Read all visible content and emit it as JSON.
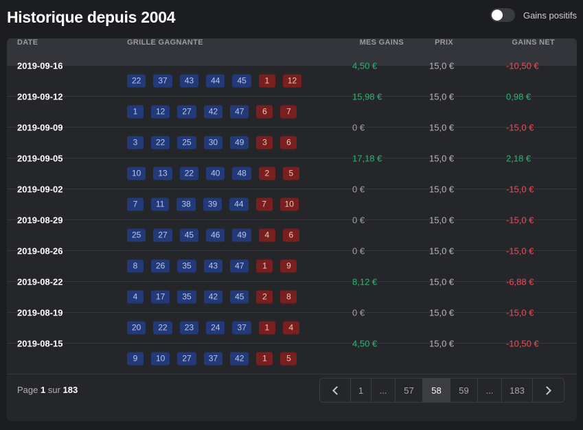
{
  "header": {
    "title": "Historique depuis 2004",
    "toggle_label": "Gains positifs",
    "toggle_on": false
  },
  "table": {
    "columns": {
      "date": "DATE",
      "grille": "GRILLE GAGNANTE",
      "mes_gains": "MES GAINS",
      "prix": "PRIX",
      "gains_net": "GAINS NET"
    },
    "rows": [
      {
        "date": "2019-09-16",
        "balls": [
          "22",
          "37",
          "43",
          "44",
          "45"
        ],
        "stars": [
          "1",
          "12"
        ],
        "gains": "4,50 €",
        "gains_type": "pos",
        "prix": "15,0 €",
        "net": "-10,50 €",
        "net_type": "neg"
      },
      {
        "date": "2019-09-12",
        "balls": [
          "1",
          "12",
          "27",
          "42",
          "47"
        ],
        "stars": [
          "6",
          "7"
        ],
        "gains": "15,98 €",
        "gains_type": "pos",
        "prix": "15,0 €",
        "net": "0,98 €",
        "net_type": "pos"
      },
      {
        "date": "2019-09-09",
        "balls": [
          "3",
          "22",
          "25",
          "30",
          "49"
        ],
        "stars": [
          "3",
          "6"
        ],
        "gains": "0 €",
        "gains_type": "zero",
        "prix": "15,0 €",
        "net": "-15,0 €",
        "net_type": "neg"
      },
      {
        "date": "2019-09-05",
        "balls": [
          "10",
          "13",
          "22",
          "40",
          "48"
        ],
        "stars": [
          "2",
          "5"
        ],
        "gains": "17,18 €",
        "gains_type": "pos",
        "prix": "15,0 €",
        "net": "2,18 €",
        "net_type": "pos"
      },
      {
        "date": "2019-09-02",
        "balls": [
          "7",
          "11",
          "38",
          "39",
          "44"
        ],
        "stars": [
          "7",
          "10"
        ],
        "gains": "0 €",
        "gains_type": "zero",
        "prix": "15,0 €",
        "net": "-15,0 €",
        "net_type": "neg"
      },
      {
        "date": "2019-08-29",
        "balls": [
          "25",
          "27",
          "45",
          "46",
          "49"
        ],
        "stars": [
          "4",
          "6"
        ],
        "gains": "0 €",
        "gains_type": "zero",
        "prix": "15,0 €",
        "net": "-15,0 €",
        "net_type": "neg"
      },
      {
        "date": "2019-08-26",
        "balls": [
          "8",
          "26",
          "35",
          "43",
          "47"
        ],
        "stars": [
          "1",
          "9"
        ],
        "gains": "0 €",
        "gains_type": "zero",
        "prix": "15,0 €",
        "net": "-15,0 €",
        "net_type": "neg"
      },
      {
        "date": "2019-08-22",
        "balls": [
          "4",
          "17",
          "35",
          "42",
          "45"
        ],
        "stars": [
          "2",
          "8"
        ],
        "gains": "8,12 €",
        "gains_type": "pos",
        "prix": "15,0 €",
        "net": "-6,88 €",
        "net_type": "neg"
      },
      {
        "date": "2019-08-19",
        "balls": [
          "20",
          "22",
          "23",
          "24",
          "37"
        ],
        "stars": [
          "1",
          "4"
        ],
        "gains": "0 €",
        "gains_type": "zero",
        "prix": "15,0 €",
        "net": "-15,0 €",
        "net_type": "neg"
      },
      {
        "date": "2019-08-15",
        "balls": [
          "9",
          "10",
          "27",
          "37",
          "42"
        ],
        "stars": [
          "1",
          "5"
        ],
        "gains": "4,50 €",
        "gains_type": "pos",
        "prix": "15,0 €",
        "net": "-10,50 €",
        "net_type": "neg"
      }
    ]
  },
  "footer": {
    "page_prefix": "Page",
    "current_page": "1",
    "page_sep": "sur",
    "total_pages": "183",
    "pagination": [
      {
        "label": "",
        "kind": "prev",
        "icon": "chevron-left-icon"
      },
      {
        "label": "1",
        "kind": "page"
      },
      {
        "label": "...",
        "kind": "ellipsis"
      },
      {
        "label": "57",
        "kind": "page"
      },
      {
        "label": "58",
        "kind": "page",
        "active": true
      },
      {
        "label": "59",
        "kind": "page"
      },
      {
        "label": "...",
        "kind": "ellipsis"
      },
      {
        "label": "183",
        "kind": "page"
      },
      {
        "label": "",
        "kind": "next",
        "icon": "chevron-right-icon"
      }
    ]
  }
}
